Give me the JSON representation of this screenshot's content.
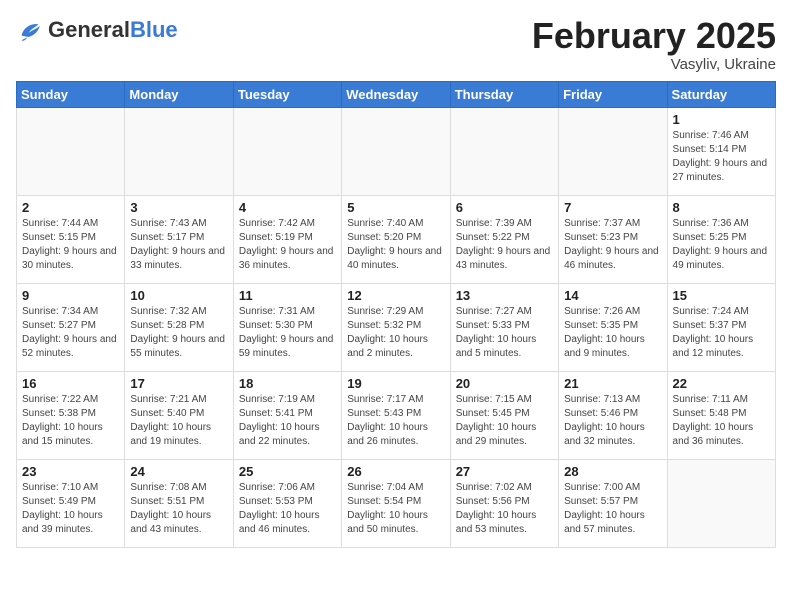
{
  "logo": {
    "general": "General",
    "blue": "Blue"
  },
  "header": {
    "month": "February 2025",
    "location": "Vasyliv, Ukraine"
  },
  "weekdays": [
    "Sunday",
    "Monday",
    "Tuesday",
    "Wednesday",
    "Thursday",
    "Friday",
    "Saturday"
  ],
  "weeks": [
    [
      {
        "day": "",
        "info": ""
      },
      {
        "day": "",
        "info": ""
      },
      {
        "day": "",
        "info": ""
      },
      {
        "day": "",
        "info": ""
      },
      {
        "day": "",
        "info": ""
      },
      {
        "day": "",
        "info": ""
      },
      {
        "day": "1",
        "info": "Sunrise: 7:46 AM\nSunset: 5:14 PM\nDaylight: 9 hours and 27 minutes."
      }
    ],
    [
      {
        "day": "2",
        "info": "Sunrise: 7:44 AM\nSunset: 5:15 PM\nDaylight: 9 hours and 30 minutes."
      },
      {
        "day": "3",
        "info": "Sunrise: 7:43 AM\nSunset: 5:17 PM\nDaylight: 9 hours and 33 minutes."
      },
      {
        "day": "4",
        "info": "Sunrise: 7:42 AM\nSunset: 5:19 PM\nDaylight: 9 hours and 36 minutes."
      },
      {
        "day": "5",
        "info": "Sunrise: 7:40 AM\nSunset: 5:20 PM\nDaylight: 9 hours and 40 minutes."
      },
      {
        "day": "6",
        "info": "Sunrise: 7:39 AM\nSunset: 5:22 PM\nDaylight: 9 hours and 43 minutes."
      },
      {
        "day": "7",
        "info": "Sunrise: 7:37 AM\nSunset: 5:23 PM\nDaylight: 9 hours and 46 minutes."
      },
      {
        "day": "8",
        "info": "Sunrise: 7:36 AM\nSunset: 5:25 PM\nDaylight: 9 hours and 49 minutes."
      }
    ],
    [
      {
        "day": "9",
        "info": "Sunrise: 7:34 AM\nSunset: 5:27 PM\nDaylight: 9 hours and 52 minutes."
      },
      {
        "day": "10",
        "info": "Sunrise: 7:32 AM\nSunset: 5:28 PM\nDaylight: 9 hours and 55 minutes."
      },
      {
        "day": "11",
        "info": "Sunrise: 7:31 AM\nSunset: 5:30 PM\nDaylight: 9 hours and 59 minutes."
      },
      {
        "day": "12",
        "info": "Sunrise: 7:29 AM\nSunset: 5:32 PM\nDaylight: 10 hours and 2 minutes."
      },
      {
        "day": "13",
        "info": "Sunrise: 7:27 AM\nSunset: 5:33 PM\nDaylight: 10 hours and 5 minutes."
      },
      {
        "day": "14",
        "info": "Sunrise: 7:26 AM\nSunset: 5:35 PM\nDaylight: 10 hours and 9 minutes."
      },
      {
        "day": "15",
        "info": "Sunrise: 7:24 AM\nSunset: 5:37 PM\nDaylight: 10 hours and 12 minutes."
      }
    ],
    [
      {
        "day": "16",
        "info": "Sunrise: 7:22 AM\nSunset: 5:38 PM\nDaylight: 10 hours and 15 minutes."
      },
      {
        "day": "17",
        "info": "Sunrise: 7:21 AM\nSunset: 5:40 PM\nDaylight: 10 hours and 19 minutes."
      },
      {
        "day": "18",
        "info": "Sunrise: 7:19 AM\nSunset: 5:41 PM\nDaylight: 10 hours and 22 minutes."
      },
      {
        "day": "19",
        "info": "Sunrise: 7:17 AM\nSunset: 5:43 PM\nDaylight: 10 hours and 26 minutes."
      },
      {
        "day": "20",
        "info": "Sunrise: 7:15 AM\nSunset: 5:45 PM\nDaylight: 10 hours and 29 minutes."
      },
      {
        "day": "21",
        "info": "Sunrise: 7:13 AM\nSunset: 5:46 PM\nDaylight: 10 hours and 32 minutes."
      },
      {
        "day": "22",
        "info": "Sunrise: 7:11 AM\nSunset: 5:48 PM\nDaylight: 10 hours and 36 minutes."
      }
    ],
    [
      {
        "day": "23",
        "info": "Sunrise: 7:10 AM\nSunset: 5:49 PM\nDaylight: 10 hours and 39 minutes."
      },
      {
        "day": "24",
        "info": "Sunrise: 7:08 AM\nSunset: 5:51 PM\nDaylight: 10 hours and 43 minutes."
      },
      {
        "day": "25",
        "info": "Sunrise: 7:06 AM\nSunset: 5:53 PM\nDaylight: 10 hours and 46 minutes."
      },
      {
        "day": "26",
        "info": "Sunrise: 7:04 AM\nSunset: 5:54 PM\nDaylight: 10 hours and 50 minutes."
      },
      {
        "day": "27",
        "info": "Sunrise: 7:02 AM\nSunset: 5:56 PM\nDaylight: 10 hours and 53 minutes."
      },
      {
        "day": "28",
        "info": "Sunrise: 7:00 AM\nSunset: 5:57 PM\nDaylight: 10 hours and 57 minutes."
      },
      {
        "day": "",
        "info": ""
      }
    ]
  ]
}
